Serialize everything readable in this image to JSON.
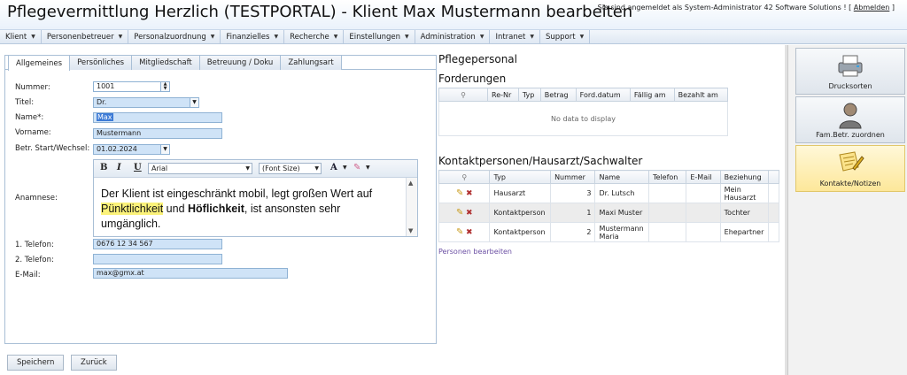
{
  "title": "Pflegevermittlung Herzlich (TESTPORTAL) - Klient Max Mustermann bearbeiten",
  "user_info": {
    "text": "Sie sind angemeldet als System-Administrator 42 Software Solutions ! [",
    "logout": "Abmelden",
    "close": " ]"
  },
  "menu": [
    {
      "label": "Klient"
    },
    {
      "label": "Personenbetreuer"
    },
    {
      "label": "Personalzuordnung"
    },
    {
      "label": "Finanzielles"
    },
    {
      "label": "Recherche"
    },
    {
      "label": "Einstellungen"
    },
    {
      "label": "Administration"
    },
    {
      "label": "Intranet"
    },
    {
      "label": "Support"
    }
  ],
  "tabs": [
    {
      "label": "Allgemeines"
    },
    {
      "label": "Persönliches"
    },
    {
      "label": "Mitgliedschaft"
    },
    {
      "label": "Betreuung / Doku"
    },
    {
      "label": "Zahlungsart"
    }
  ],
  "form": {
    "nummer_label": "Nummer:",
    "nummer_value": "1001",
    "titel_label": "Titel:",
    "titel_value": "Dr.",
    "name_label": "Name*:",
    "name_value": "Max",
    "vorname_label": "Vorname:",
    "vorname_value": "Mustermann",
    "start_label": "Betr. Start/Wechsel:",
    "start_value": "01.02.2024",
    "anamnese_label": "Anamnese:",
    "tel1_label": "1. Telefon:",
    "tel1_value": "0676 12 34 567",
    "tel2_label": "2. Telefon:",
    "tel2_value": "",
    "email_label": "E-Mail:",
    "email_value": "max@gmx.at"
  },
  "editor": {
    "bold": "B",
    "italic": "I",
    "underline": "U",
    "font": "Arial",
    "font_size": "(Font Size)",
    "font_color": "A",
    "text_1": "Der Klient ist eingeschränkt mobil, legt großen Wert auf ",
    "text_highlight": "Pünktlichkeit",
    "text_2": " und ",
    "text_bold": "Höflichkeit",
    "text_3": ", ist ansonsten sehr umgänglich."
  },
  "buttons": {
    "save": "Speichern",
    "back": "Zurück"
  },
  "pflegepersonal_heading": "Pflegepersonal",
  "forderungen": {
    "heading": "Forderungen",
    "columns": [
      "Re-Nr",
      "Typ",
      "Betrag",
      "Ford.datum",
      "Fällig am",
      "Bezahlt am"
    ],
    "empty_text": "No data to display"
  },
  "kontakt": {
    "heading": "Kontaktpersonen/Hausarzt/Sachwalter",
    "columns": [
      "Typ",
      "Nummer",
      "Name",
      "Telefon",
      "E-Mail",
      "Beziehung"
    ],
    "rows": [
      {
        "typ": "Hausarzt",
        "nummer": "3",
        "name": "Dr. Lutsch",
        "telefon": "",
        "email": "",
        "beziehung": "Mein Hausarzt"
      },
      {
        "typ": "Kontaktperson",
        "nummer": "1",
        "name": "Maxi Muster",
        "telefon": "",
        "email": "",
        "beziehung": "Tochter"
      },
      {
        "typ": "Kontaktperson",
        "nummer": "2",
        "name": "Mustermann Maria",
        "telefon": "",
        "email": "",
        "beziehung": "Ehepartner"
      }
    ],
    "edit_link": "Personen bearbeiten"
  },
  "sidebar": [
    {
      "label": "Drucksorten",
      "icon": "printer-icon"
    },
    {
      "label": "Fam.Betr. zuordnen",
      "icon": "person-icon"
    },
    {
      "label": "Kontakte/Notizen",
      "icon": "notes-icon"
    }
  ]
}
